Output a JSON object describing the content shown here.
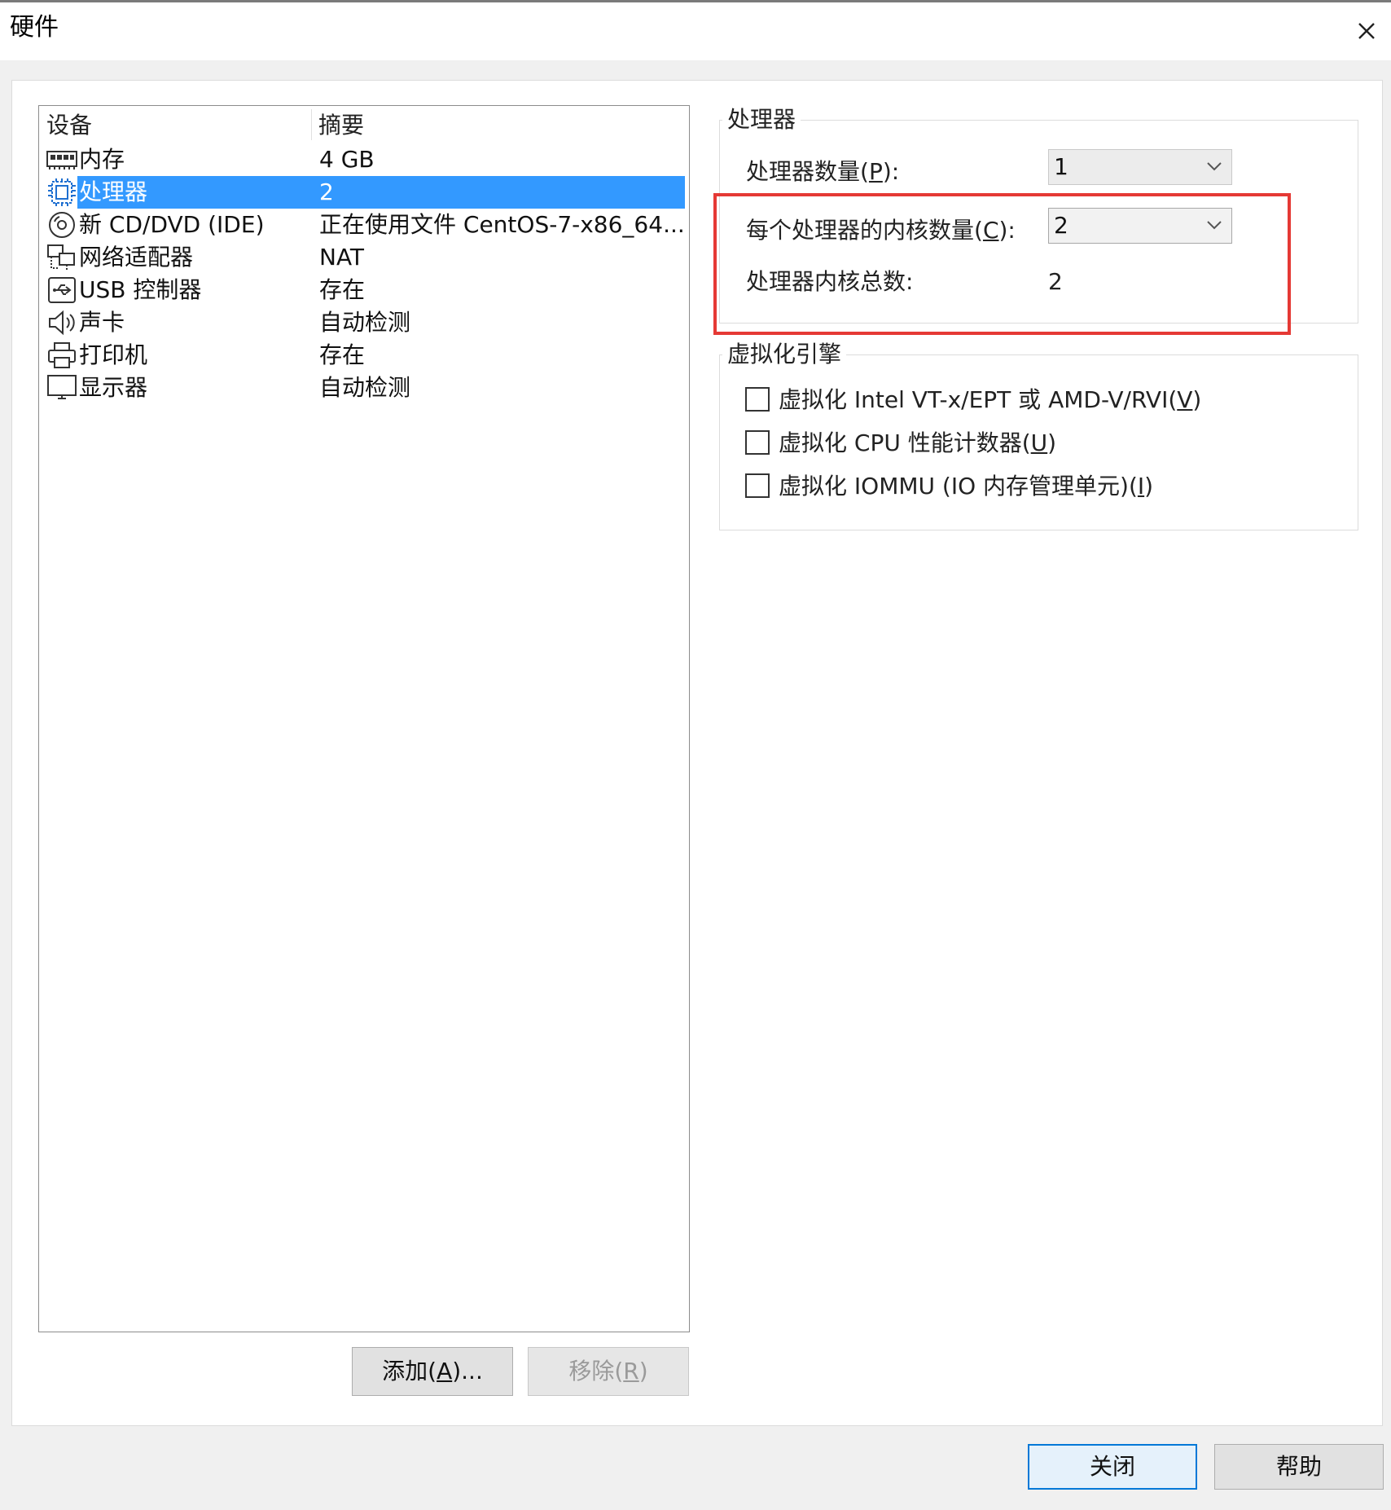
{
  "window": {
    "title": "硬件"
  },
  "device_list": {
    "columns": {
      "device": "设备",
      "summary": "摘要"
    },
    "rows": [
      {
        "name": "内存",
        "summary": "4 GB",
        "icon": "memory-icon",
        "selected": false
      },
      {
        "name": "处理器",
        "summary": "2",
        "icon": "processor-icon",
        "selected": true
      },
      {
        "name": "新 CD/DVD (IDE)",
        "summary": "正在使用文件 CentOS-7-x86_64...",
        "icon": "cd-dvd-icon",
        "selected": false
      },
      {
        "name": "网络适配器",
        "summary": "NAT",
        "icon": "network-adapter-icon",
        "selected": false
      },
      {
        "name": "USB 控制器",
        "summary": "存在",
        "icon": "usb-icon",
        "selected": false
      },
      {
        "name": "声卡",
        "summary": "自动检测",
        "icon": "sound-card-icon",
        "selected": false
      },
      {
        "name": "打印机",
        "summary": "存在",
        "icon": "printer-icon",
        "selected": false
      },
      {
        "name": "显示器",
        "summary": "自动检测",
        "icon": "display-icon",
        "selected": false
      }
    ],
    "add_button": "添加(A)...",
    "add_button_pre": "添加(",
    "add_button_key": "A",
    "add_button_post": ")...",
    "remove_button_pre": "移除(",
    "remove_button_key": "R",
    "remove_button_post": ")"
  },
  "processor_group": {
    "title": "处理器",
    "num_processors_label_pre": "处理器数量(",
    "num_processors_label_key": "P",
    "num_processors_label_post": "):",
    "num_processors_value": "1",
    "cores_per_processor_label_pre": "每个处理器的内核数量(",
    "cores_per_processor_label_key": "C",
    "cores_per_processor_label_post": "):",
    "cores_per_processor_value": "2",
    "total_cores_label": "处理器内核总数:",
    "total_cores_value": "2"
  },
  "virtualization_group": {
    "title": "虚拟化引擎",
    "options": [
      {
        "pre": "虚拟化 Intel VT-x/EPT 或 AMD-V/RVI(",
        "key": "V",
        "post": ")",
        "checked": false
      },
      {
        "pre": "虚拟化 CPU 性能计数器(",
        "key": "U",
        "post": ")",
        "checked": false
      },
      {
        "pre": "虚拟化 IOMMU (IO 内存管理单元)(",
        "key": "I",
        "post": ")",
        "checked": false
      }
    ]
  },
  "footer": {
    "close_button": "关闭",
    "help_button": "帮助"
  },
  "colors": {
    "selection": "#3399ff",
    "highlight_box": "#e53935",
    "primary_border": "#0078d7"
  }
}
